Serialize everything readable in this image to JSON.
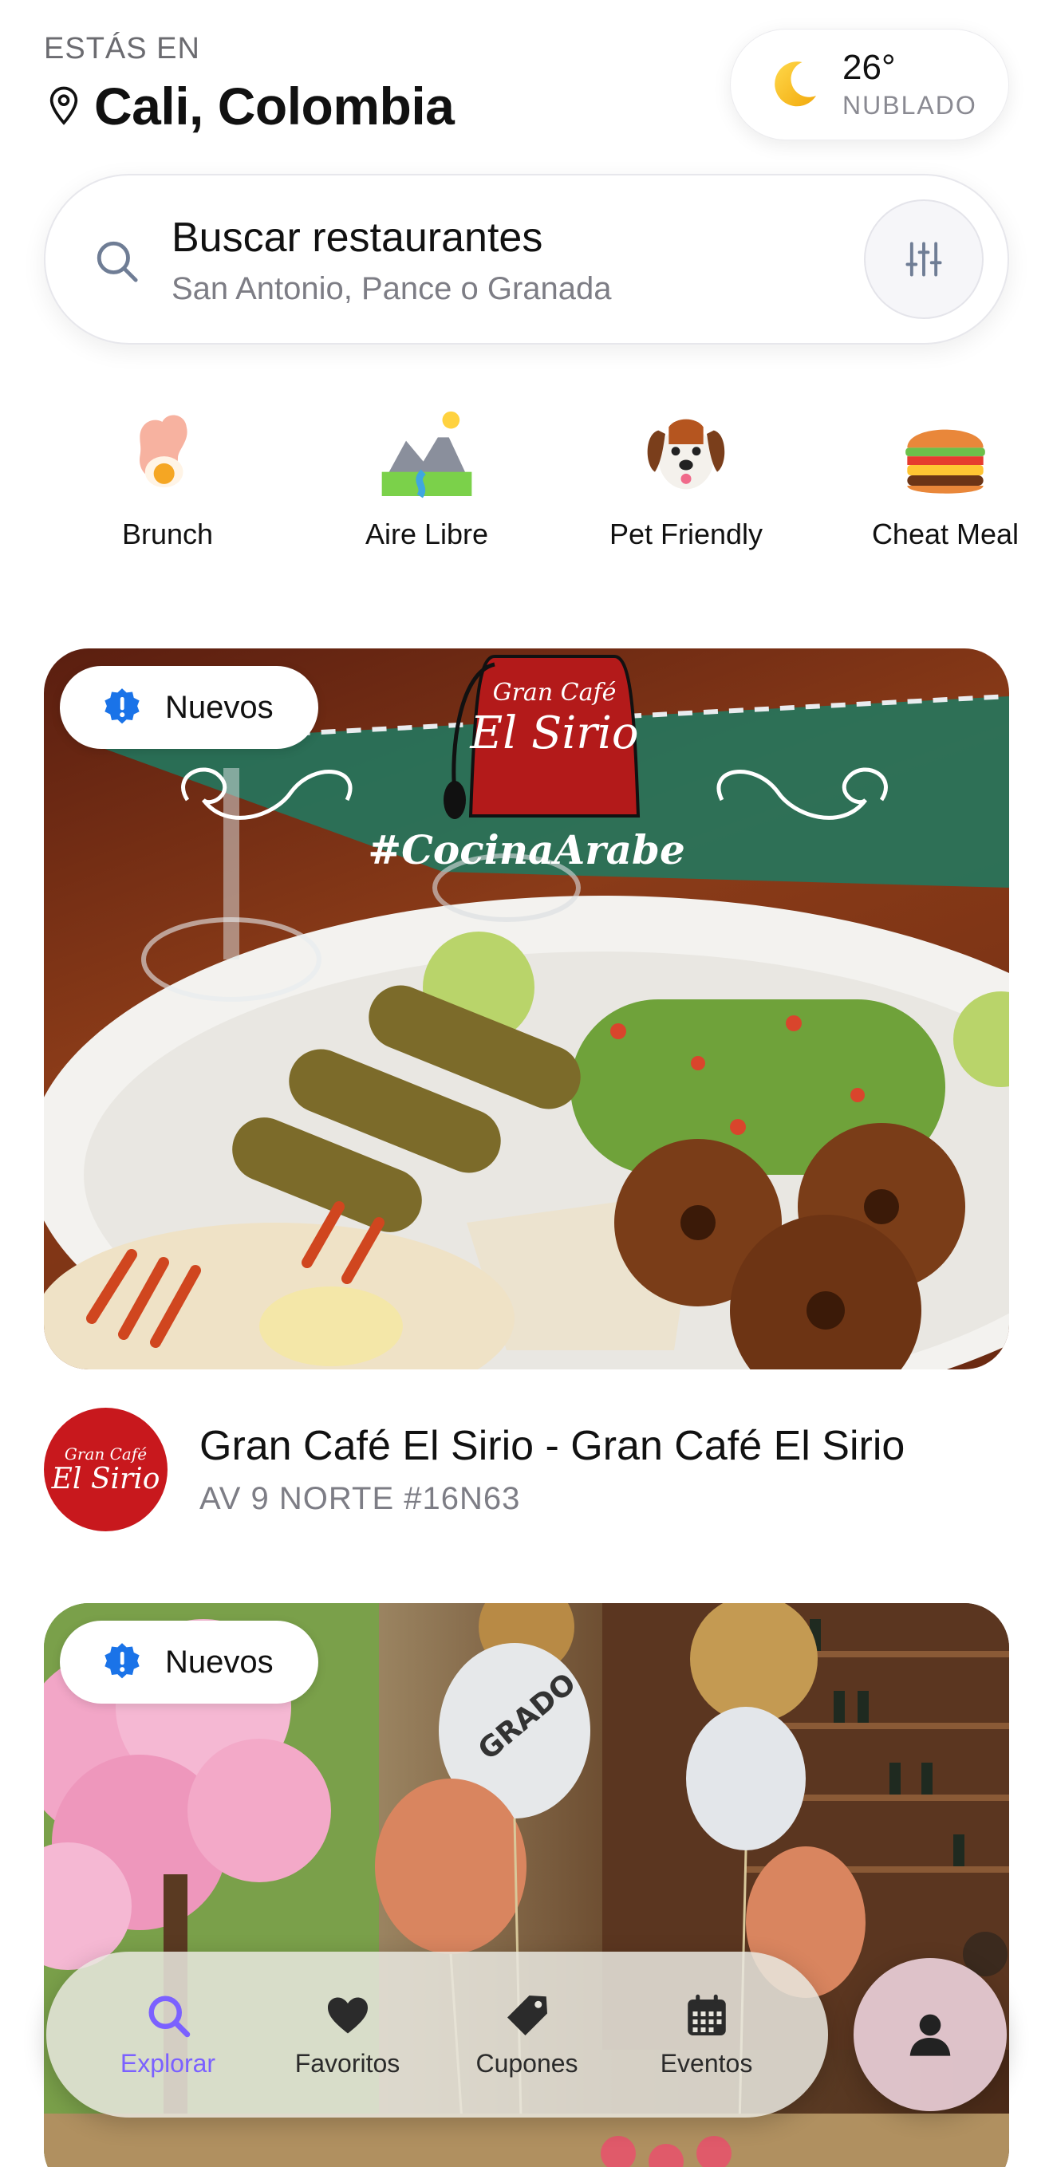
{
  "header": {
    "location_label": "ESTÁS EN",
    "city": "Cali, Colombia"
  },
  "weather": {
    "temperature": "26°",
    "condition": "NUBLADO",
    "icon": "moon-icon"
  },
  "search": {
    "title": "Buscar restaurantes",
    "subtitle": "San Antonio, Pance o Granada"
  },
  "categories": [
    {
      "label": "Brunch",
      "icon": "egg-brunch-icon"
    },
    {
      "label": "Aire Libre",
      "icon": "mountain-outdoor-icon"
    },
    {
      "label": "Pet Friendly",
      "icon": "dog-icon"
    },
    {
      "label": "Cheat Meal",
      "icon": "burger-icon"
    }
  ],
  "restaurants": [
    {
      "badge": "Nuevos",
      "image_caption": "#CocinaArabe",
      "logo_text_top": "Gran Café",
      "logo_text_main": "El Sirio",
      "name": "Gran Café El Sirio  - Gran Café El Sirio",
      "address": "AV 9 NORTE #16N63"
    },
    {
      "badge": "Nuevos",
      "balloon_text": "GRADO"
    }
  ],
  "bottom_nav": {
    "items": [
      {
        "label": "Explorar",
        "icon": "search-icon",
        "active": true
      },
      {
        "label": "Favoritos",
        "icon": "heart-icon",
        "active": false
      },
      {
        "label": "Cupones",
        "icon": "tag-icon",
        "active": false
      },
      {
        "label": "Eventos",
        "icon": "calendar-icon",
        "active": false
      }
    ],
    "profile_icon": "user-icon"
  },
  "colors": {
    "accent": "#7b61ff",
    "badge_icon": "#1a73e8",
    "logo_red": "#c8181d"
  }
}
